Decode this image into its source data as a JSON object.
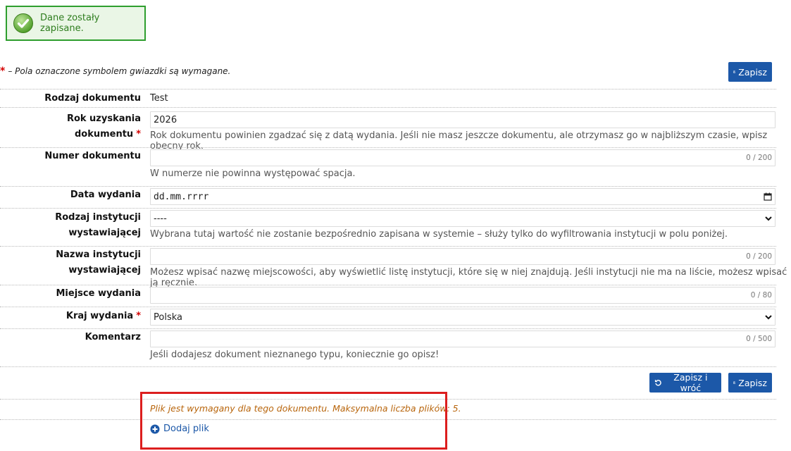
{
  "alert": {
    "message": "Dane zostały zapisane.",
    "icon": "check-circle-icon"
  },
  "required_note": {
    "star": "*",
    "text": "– Pola oznaczone symbolem gwiazdki są wymagane."
  },
  "buttons": {
    "save_top": "Zapisz",
    "save_return": "Zapisz i wróć",
    "save_bottom": "Zapisz"
  },
  "form": {
    "doc_type": {
      "label": "Rodzaj dokumentu",
      "value": "Test"
    },
    "year": {
      "label": "Rok uzyskania dokumentu",
      "star": "*",
      "value": "2026",
      "help": "Rok dokumentu powinien zgadzać się z datą wydania. Jeśli nie masz jeszcze dokumentu, ale otrzymasz go w najbliższym czasie, wpisz obecny rok."
    },
    "number": {
      "label": "Numer dokumentu",
      "counter": "0 / 200",
      "help": "W numerze nie powinna występować spacja."
    },
    "issue_date": {
      "label": "Data wydania",
      "placeholder": "dd.mm.rrrr"
    },
    "institution_type": {
      "label_line1": "Rodzaj instytucji",
      "label_line2": "wystawiającej",
      "selected": "----",
      "help": "Wybrana tutaj wartość nie zostanie bezpośrednio zapisana w systemie – służy tylko do wyfiltrowania instytucji w polu poniżej."
    },
    "institution_name": {
      "label_line1": "Nazwa instytucji",
      "label_line2": "wystawiającej",
      "counter": "0 / 200",
      "help": "Możesz wpisać nazwę miejscowości, aby wyświetlić listę instytucji, które się w niej znajdują. Jeśli instytucji nie ma na liście, możesz wpisać ją ręcznie."
    },
    "place": {
      "label": "Miejsce wydania",
      "counter": "0 / 80"
    },
    "country": {
      "label": "Kraj wydania",
      "star": "*",
      "selected": "Polska"
    },
    "comment": {
      "label": "Komentarz",
      "counter": "0 / 500",
      "help": "Jeśli dodajesz dokument nieznanego typu, koniecznie go opisz!"
    }
  },
  "files": {
    "note": "Plik jest wymagany dla tego dokumentu. Maksymalna liczba plików: 5.",
    "add_label": "Dodaj plik"
  },
  "colors": {
    "primary": "#1c58a8",
    "success_border": "#2e9e2e",
    "success_text": "#2e7d1e",
    "required": "#d40000",
    "warning": "#b8650c",
    "highlight": "#dc1e1e"
  }
}
